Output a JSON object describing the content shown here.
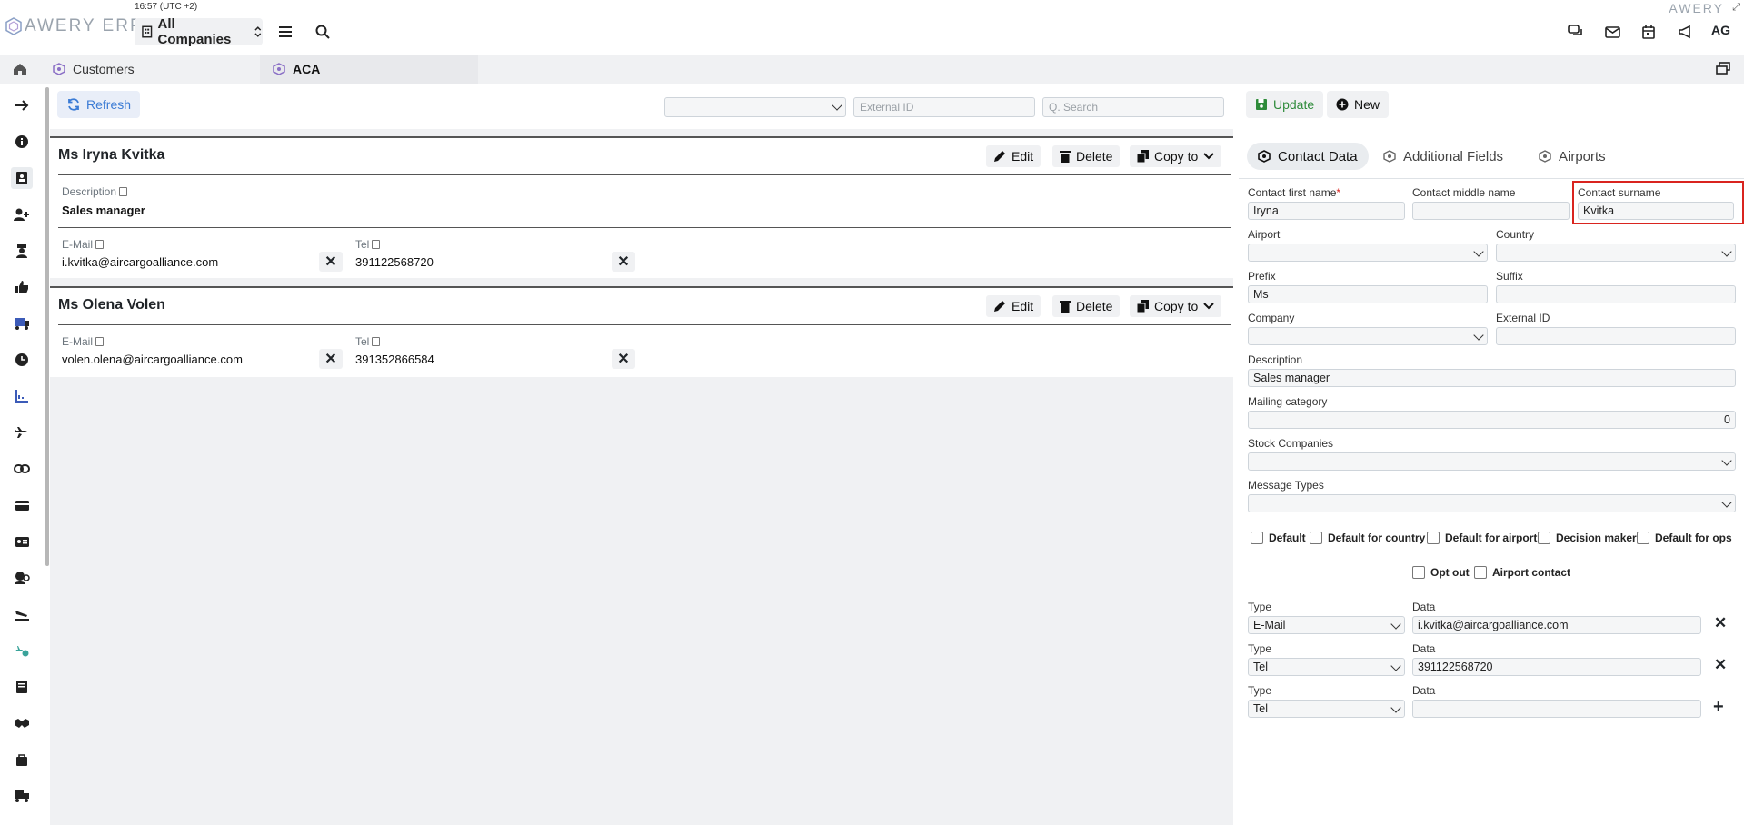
{
  "topbar": {
    "brand": "AWERY ERP",
    "time": "16:57 (UTC +2)",
    "company": "All Companies",
    "brand_right": "AWERY",
    "user": "AG"
  },
  "tabs": [
    {
      "label": "Customers"
    },
    {
      "label": "ACA"
    }
  ],
  "toolbar": {
    "refresh": "Refresh",
    "external_id_placeholder": "External ID",
    "search_placeholder": "Q. Search"
  },
  "contacts": [
    {
      "name": "Ms Iryna Kvitka",
      "description_label": "Description",
      "description": "Sales manager",
      "email_label": "E-Mail",
      "email": "i.kvitka@aircargoalliance.com",
      "tel_label": "Tel",
      "tel": "391122568720"
    },
    {
      "name": "Ms Olena Volen",
      "email_label": "E-Mail",
      "email": "volen.olena@aircargoalliance.com",
      "tel_label": "Tel",
      "tel": "391352866584"
    }
  ],
  "card_actions": {
    "edit": "Edit",
    "delete": "Delete",
    "copy": "Copy to"
  },
  "form": {
    "update": "Update",
    "new": "New",
    "tabs": [
      "Contact Data",
      "Additional Fields",
      "Airports"
    ],
    "first_name_label": "Contact first name",
    "first_name_required": "*",
    "first_name": "Iryna",
    "middle_name_label": "Contact middle name",
    "middle_name": "",
    "surname_label": "Contact surname",
    "surname": "Kvitka",
    "airport_label": "Airport",
    "country_label": "Country",
    "prefix_label": "Prefix",
    "prefix": "Ms",
    "suffix_label": "Suffix",
    "company_label": "Company",
    "external_id_label": "External ID",
    "description_label": "Description",
    "description": "Sales manager",
    "mailing_label": "Mailing category",
    "mailing": "0",
    "stock_label": "Stock Companies",
    "message_label": "Message Types",
    "checks": [
      "Default",
      "Default for country",
      "Default for airport",
      "Decision maker",
      "Default for ops",
      "Opt out",
      "Airport contact"
    ],
    "type_label": "Type",
    "data_label": "Data",
    "rows": [
      {
        "type": "E-Mail",
        "data": "i.kvitka@aircargoalliance.com"
      },
      {
        "type": "Tel",
        "data": "391122568720"
      },
      {
        "type": "Tel",
        "data": ""
      }
    ]
  }
}
